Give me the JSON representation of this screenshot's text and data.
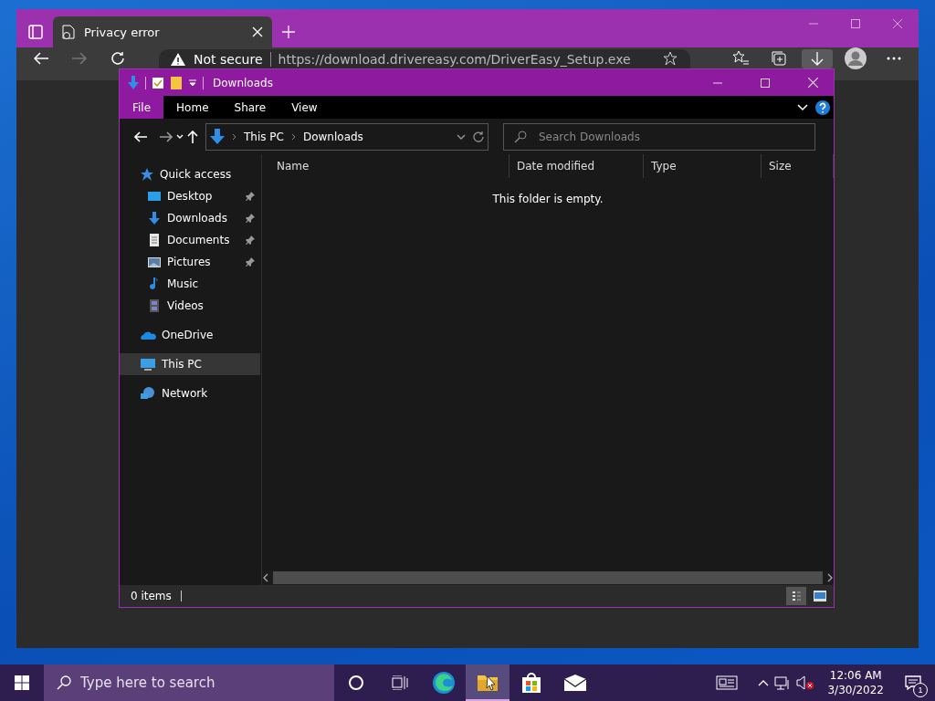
{
  "browser": {
    "tab": {
      "title": "Privacy error"
    },
    "address": {
      "security": "Not secure",
      "url": "https://download.drivereasy.com/DriverEasy_Setup.exe"
    }
  },
  "explorer": {
    "title": "Downloads",
    "ribbon_tabs": [
      {
        "label": "File",
        "selected": true
      },
      {
        "label": "Home",
        "selected": false
      },
      {
        "label": "Share",
        "selected": false
      },
      {
        "label": "View",
        "selected": false
      }
    ],
    "breadcrumb": [
      "This PC",
      "Downloads"
    ],
    "search": {
      "placeholder": "Search Downloads"
    },
    "nav_items": [
      {
        "label": "Quick access",
        "kind": "star",
        "selected": false,
        "children": [
          {
            "label": "Desktop",
            "kind": "desktop",
            "pinned": true,
            "selected": false
          },
          {
            "label": "Downloads",
            "kind": "download",
            "pinned": true,
            "selected": false
          },
          {
            "label": "Documents",
            "kind": "document",
            "pinned": true,
            "selected": false
          },
          {
            "label": "Pictures",
            "kind": "pictures",
            "pinned": true,
            "selected": false
          },
          {
            "label": "Music",
            "kind": "music",
            "pinned": false,
            "selected": false
          },
          {
            "label": "Videos",
            "kind": "videos",
            "pinned": false,
            "selected": false
          }
        ]
      },
      {
        "label": "OneDrive",
        "kind": "cloud",
        "selected": false
      },
      {
        "label": "This PC",
        "kind": "computer",
        "selected": true
      },
      {
        "label": "Network",
        "kind": "network",
        "selected": false
      }
    ],
    "columns": [
      "Name",
      "Date modified",
      "Type",
      "Size"
    ],
    "empty_message": "This folder is empty.",
    "status": "0 items"
  },
  "taskbar": {
    "search": {
      "placeholder": "Type here to search"
    },
    "apps": [
      {
        "kind": "edge",
        "selected": false
      },
      {
        "kind": "explorer",
        "selected": true
      },
      {
        "kind": "store",
        "selected": false
      },
      {
        "kind": "mail",
        "selected": false
      }
    ],
    "clock": {
      "time": "12:06 AM",
      "date": "3/30/2022"
    },
    "notification_count": "1"
  }
}
